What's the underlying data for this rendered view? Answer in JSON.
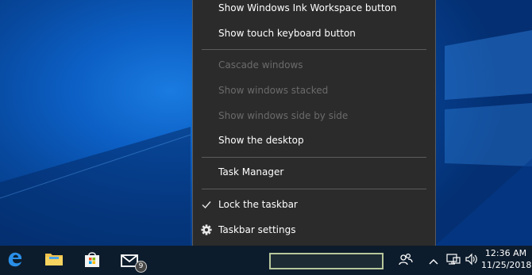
{
  "context_menu": {
    "items": [
      {
        "label": "Show Windows Ink Workspace button",
        "enabled": true
      },
      {
        "label": "Show touch keyboard button",
        "enabled": true
      },
      {
        "label": "Cascade windows",
        "enabled": false
      },
      {
        "label": "Show windows stacked",
        "enabled": false
      },
      {
        "label": "Show windows side by side",
        "enabled": false
      },
      {
        "label": "Show the desktop",
        "enabled": true
      },
      {
        "label": "Task Manager",
        "enabled": true
      },
      {
        "label": "Lock the taskbar",
        "enabled": true,
        "checked": true,
        "icon": "checkmark-icon"
      },
      {
        "label": "Taskbar settings",
        "enabled": true,
        "icon": "gear-icon"
      }
    ]
  },
  "taskbar": {
    "pinned": [
      {
        "name": "edge",
        "icon": "edge-icon"
      },
      {
        "name": "file-explorer",
        "icon": "folder-icon"
      },
      {
        "name": "store",
        "icon": "store-icon"
      },
      {
        "name": "mail",
        "icon": "mail-icon",
        "badge": "9"
      }
    ],
    "tray": [
      "people-icon",
      "chevron-up-icon",
      "network-icon",
      "volume-icon"
    ],
    "clock": {
      "time": "12:36 AM",
      "date": "11/25/2018"
    }
  },
  "colors": {
    "menu_bg": "#2b2b2b",
    "taskbar_bg": "#0d1c2c",
    "desktop_blue": "#0c5fc4"
  }
}
